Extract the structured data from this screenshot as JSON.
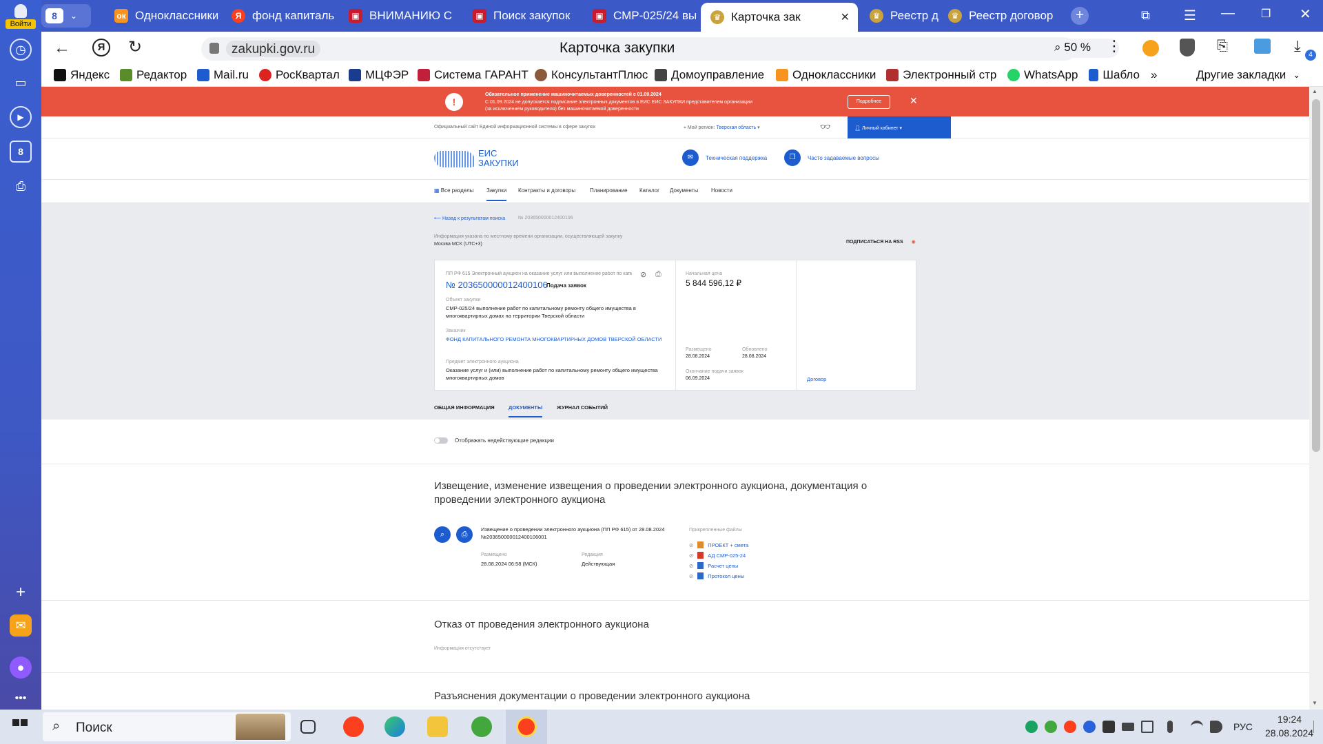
{
  "browser": {
    "tabs": [
      {
        "label": "",
        "count": "8"
      },
      {
        "label": "Одноклассники"
      },
      {
        "label": "фонд капиталь"
      },
      {
        "label": "ВНИМАНИЮ С"
      },
      {
        "label": "Поиск закупок"
      },
      {
        "label": "СМР-025/24 вы"
      },
      {
        "label": "Карточка зак"
      },
      {
        "label": "Реестр договор"
      },
      {
        "label": "Реестр договор"
      }
    ],
    "sidebar_login": "Войти",
    "sidebar_badge": "8",
    "url": "zakupki.gov.ru",
    "page_title": "Карточка закупки",
    "zoom": "50 %",
    "downloads_count": "4",
    "bookmarks": [
      "Яндекс",
      "Редактор",
      "Mail.ru",
      "РосКвартал",
      "МЦФЭР",
      "Система ГАРАНТ",
      "КонсультантПлюс",
      "Домоуправление",
      "Одноклассники",
      "Электронный стр",
      "WhatsApp",
      "Шабло"
    ],
    "bookmarks_more": "»",
    "other_bookmarks": "Другие закладки"
  },
  "notice": {
    "title": "Обязательное применение машиночитаемых доверенностей с 01.09.2024",
    "text1": "С 01.09.2024 не допускается подписание электронных документов в ЕИС ЕИС ЗАКУПКИ представителем организации",
    "text2": "(за исключением руководителя) без машиночитаемой доверенности",
    "more_btn": "Подробнее"
  },
  "site": {
    "official": "Официальный сайт Единой информационной системы в сфере закупок",
    "region_label": "Мой регион:",
    "region": "Тверская область",
    "cabinet": "Личный кабинет",
    "logo1": "ЕИС",
    "logo2": "ЗАКУПКИ",
    "support": "Техническая поддержка",
    "faq": "Часто задаваемые вопросы",
    "menu": [
      "Все разделы",
      "Закупки",
      "Контракты и договоры",
      "Планирование",
      "Каталог",
      "Документы",
      "Новости"
    ]
  },
  "card": {
    "back": "Назад к результатам поиска",
    "crumb": "№ 203650000012400106",
    "tz_note": "Информация указана по местному времени организации, осуществляющей закупку",
    "tz": "Москва МСК (UTC+3)",
    "rss": "ПОДПИСАТЬСЯ НА RSS",
    "kind": "ПП РФ 615 Электронный аукцион на оказание услуг или выполнение работ по капи...",
    "number": "№ 203650000012400106",
    "stage": "Подача заявок",
    "object_label": "Объект закупки",
    "object": "СМР-025/24 выполнение работ по капитальному ремонту общего имущества в многоквартирных домах на территории Тверской области",
    "customer_label": "Заказчик",
    "customer": "ФОНД КАПИТАЛЬНОГО РЕМОНТА МНОГОКВАРТИРНЫХ ДОМОВ ТВЕРСКОЙ ОБЛАСТИ",
    "subject_label": "Предмет электронного аукциона",
    "subject": "Оказание услуг и (или) выполнение работ по капитальному ремонту общего имущества многоквартирных домов",
    "price_label": "Начальная цена",
    "price": "5 844 596,12 ₽",
    "posted_label": "Размещено",
    "posted": "28.08.2024",
    "updated_label": "Обновлено",
    "updated": "28.08.2024",
    "deadline_label": "Окончание подачи заявок",
    "deadline": "06.09.2024",
    "contract_link": "Договор"
  },
  "subtabs": [
    "ОБЩАЯ ИНФОРМАЦИЯ",
    "ДОКУМЕНТЫ",
    "ЖУРНАЛ СОБЫТИЙ"
  ],
  "docs": {
    "toggle": "Отображать недействующие редакции",
    "sec1_title": "Извещение, изменение извещения о проведении электронного аукциона, документация о проведении электронного аукциона",
    "doc_name": "Извещение о проведении электронного аукциона (ПП РФ 615) от 28.08.2024 №203650000012400106001",
    "placed_label": "Размещено",
    "placed": "28.08.2024 06:58 (МСК)",
    "edition_label": "Редакция",
    "edition": "Действующая",
    "attached_label": "Прикрепленные файлы",
    "files": [
      "ПРОЕКТ + смета",
      "АД СМР-025-24",
      "Расчет цены",
      "Протокол цены"
    ],
    "sec2_title": "Отказ от проведения электронного аукциона",
    "sec2_empty": "Информация отсутствует",
    "sec3_title": "Разъяснения документации о проведении электронного аукциона"
  },
  "taskbar": {
    "search": "Поиск",
    "lang": "РУС",
    "time": "19:24",
    "date": "28.08.2024"
  }
}
